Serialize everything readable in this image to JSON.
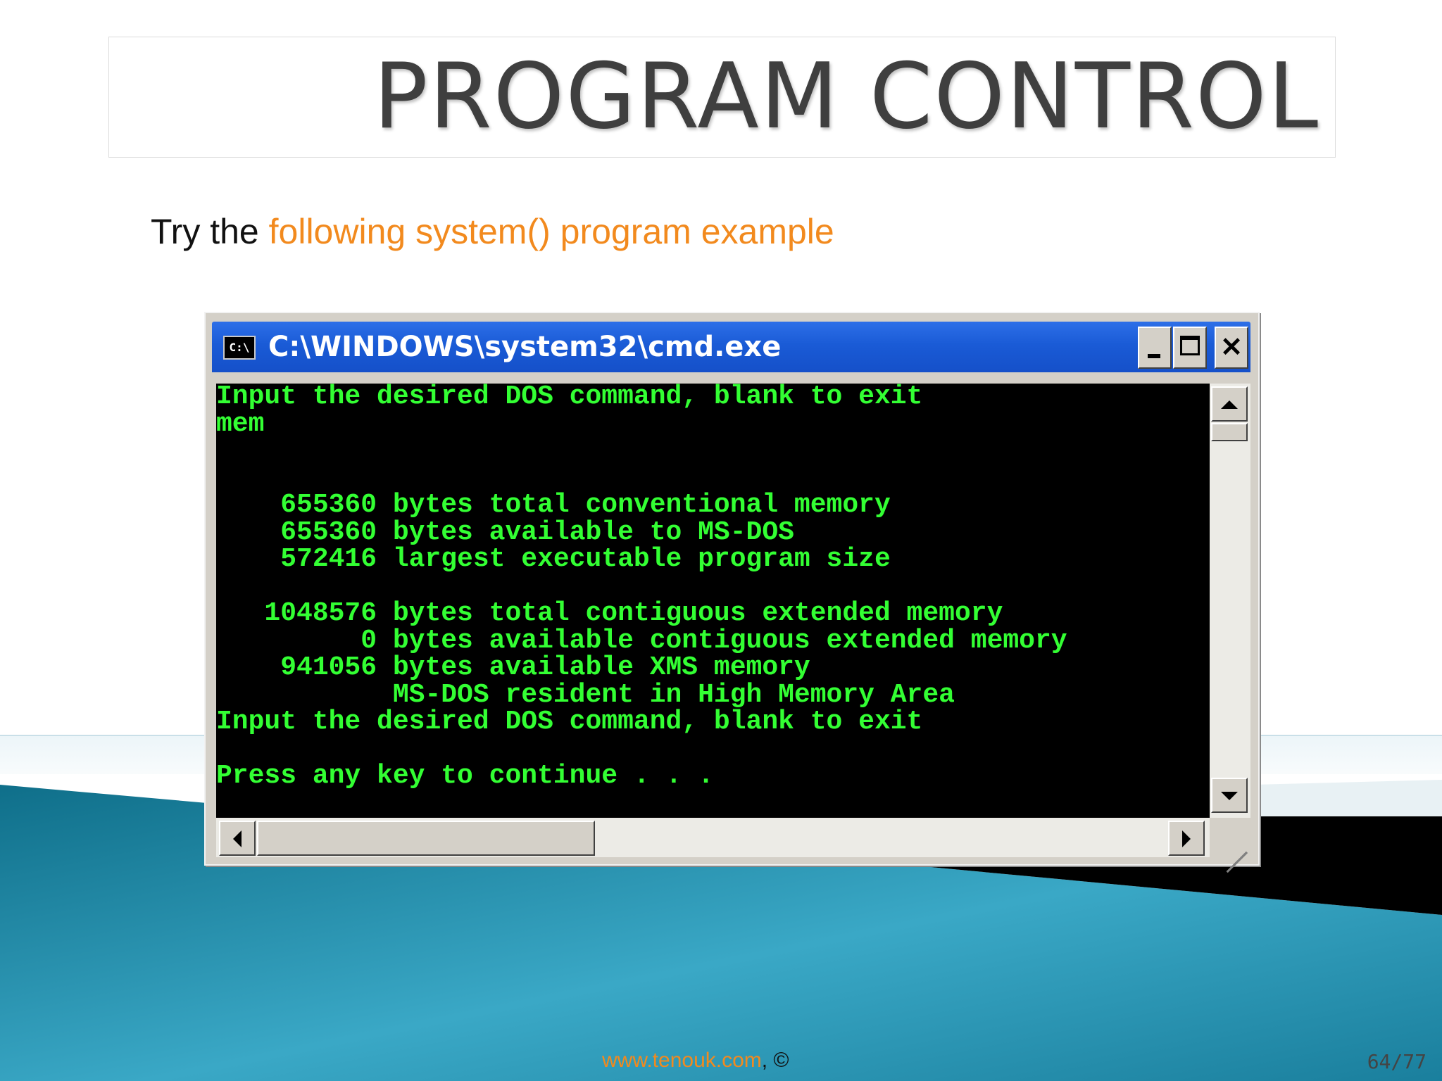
{
  "slide": {
    "title": "PROGRAM CONTROL",
    "subtitle_prefix": "Try the ",
    "subtitle_highlight": "following system() program example",
    "footer_link": "www.tenouk.com",
    "footer_suffix": ", ©",
    "page_number": "64/77"
  },
  "window": {
    "icon_label": "C:\\",
    "title": "C:\\WINDOWS\\system32\\cmd.exe",
    "close_label": "✕"
  },
  "console": {
    "text": "Input the desired DOS command, blank to exit\nmem\n\n\n    655360 bytes total conventional memory\n    655360 bytes available to MS-DOS\n    572416 largest executable program size\n\n   1048576 bytes total contiguous extended memory\n         0 bytes available contiguous extended memory\n    941056 bytes available XMS memory\n           MS-DOS resident in High Memory Area\nInput the desired DOS command, blank to exit\n\nPress any key to continue . . ."
  },
  "colors": {
    "accent": "#f28a1e",
    "console_text": "#33ff33",
    "titlebar": "#1a5bd6",
    "teal_background": "#1a8aa6"
  }
}
